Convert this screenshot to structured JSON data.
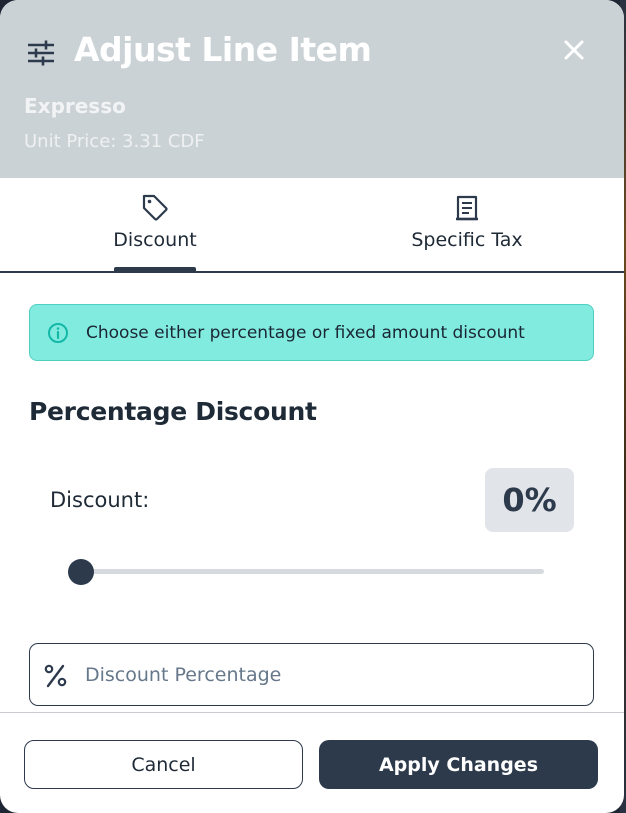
{
  "modal": {
    "title": "Adjust Line Item",
    "item_name": "Expresso",
    "unit_price_text": "Unit Price: 3.31 CDF",
    "icons": {
      "header": "sliders-icon",
      "close": "close-icon"
    }
  },
  "tabs": [
    {
      "label": "Discount",
      "icon": "tag-icon",
      "active": true
    },
    {
      "label": "Specific Tax",
      "icon": "receipt-icon",
      "active": false
    }
  ],
  "discount_panel": {
    "alert_text": "Choose either percentage or fixed amount discount",
    "section_title": "Percentage Discount",
    "discount_label": "Discount:",
    "discount_value_text": "0%",
    "slider_value_percent": 0,
    "percentage_input": {
      "value": "",
      "placeholder": "Discount Percentage"
    }
  },
  "footer": {
    "cancel_label": "Cancel",
    "apply_label": "Apply Changes"
  },
  "colors": {
    "header_bg": "#cbd2d6",
    "primary": "#2c3a4c",
    "alert_bg": "#81ebe0",
    "alert_border": "#4fcfc1"
  }
}
